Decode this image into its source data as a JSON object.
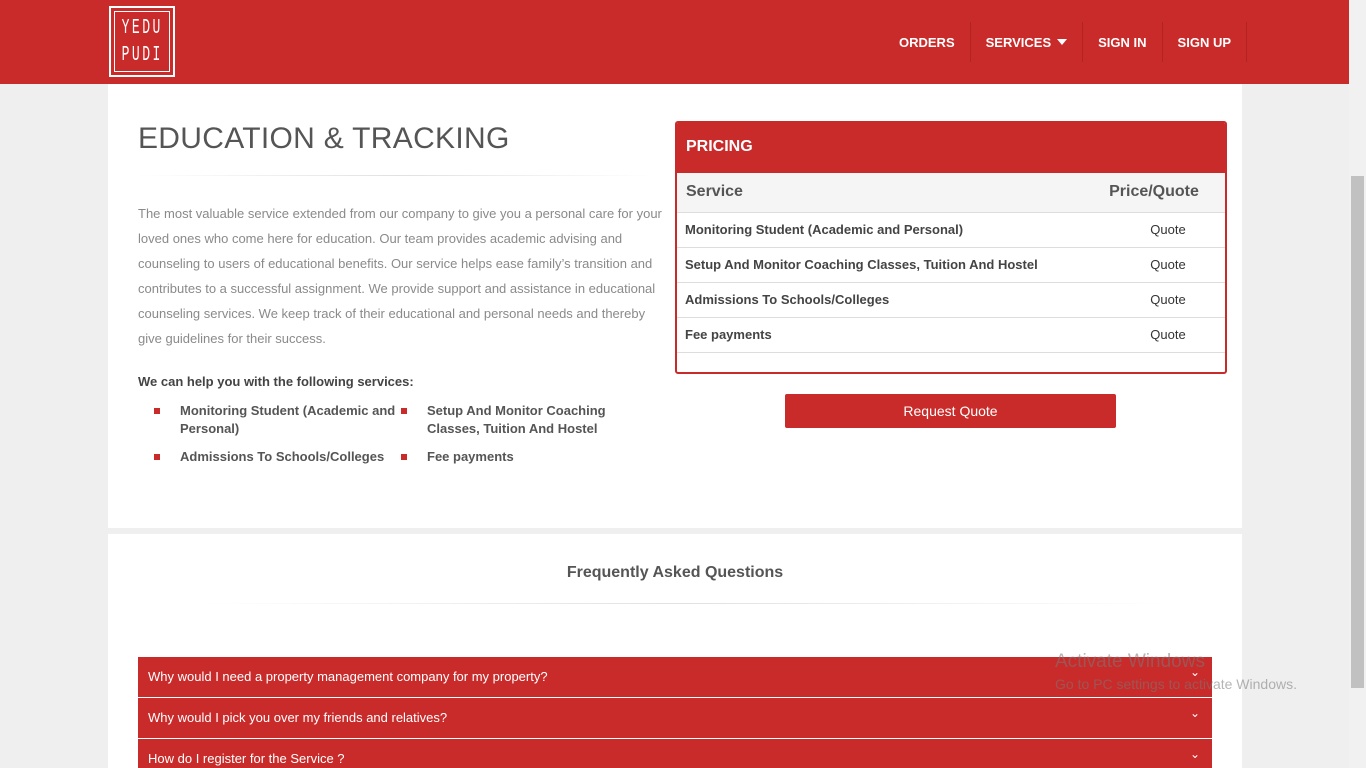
{
  "header": {
    "logo_rows": [
      "YEDU",
      "PUDI"
    ],
    "nav": [
      {
        "label": "ORDERS"
      },
      {
        "label": "SERVICES"
      },
      {
        "label": "SIGN IN"
      },
      {
        "label": "SIGN UP"
      }
    ]
  },
  "main": {
    "title": "EDUCATION & TRACKING",
    "description": "The most valuable service extended from our company to give you a personal care for your loved ones who come here for education. Our team provides academic advising and counseling to users of educational benefits. Our service helps ease family’s transition and contributes to a successful assignment. We provide support and assistance in educational counseling services. We keep track of their educational and personal needs and thereby give guidelines for their success.",
    "help_title": "We can help you with the following services:",
    "services": [
      "Monitoring Student (Academic and Personal)",
      "Setup And Monitor Coaching Classes, Tuition And Hostel",
      "Admissions To Schools/Colleges",
      "Fee payments"
    ]
  },
  "pricing": {
    "heading": "PRICING",
    "col_service": "Service",
    "col_price": "Price/Quote",
    "rows": [
      {
        "service": "Monitoring Student (Academic and Personal)",
        "price": "Quote"
      },
      {
        "service": "Setup And Monitor Coaching Classes, Tuition And Hostel",
        "price": "Quote"
      },
      {
        "service": "Admissions To Schools/Colleges",
        "price": "Quote"
      },
      {
        "service": "Fee payments",
        "price": "Quote"
      }
    ],
    "button": "Request Quote"
  },
  "faq": {
    "title": "Frequently Asked Questions",
    "items": [
      "Why would I need a property management company for my property?",
      "Why would I pick you over my friends and relatives?",
      "How do I register for the Service ?"
    ]
  },
  "watermark": {
    "line1": "Activate Windows",
    "line2": "Go to PC settings to activate Windows."
  },
  "colors": {
    "brand": "#c92b2a"
  }
}
